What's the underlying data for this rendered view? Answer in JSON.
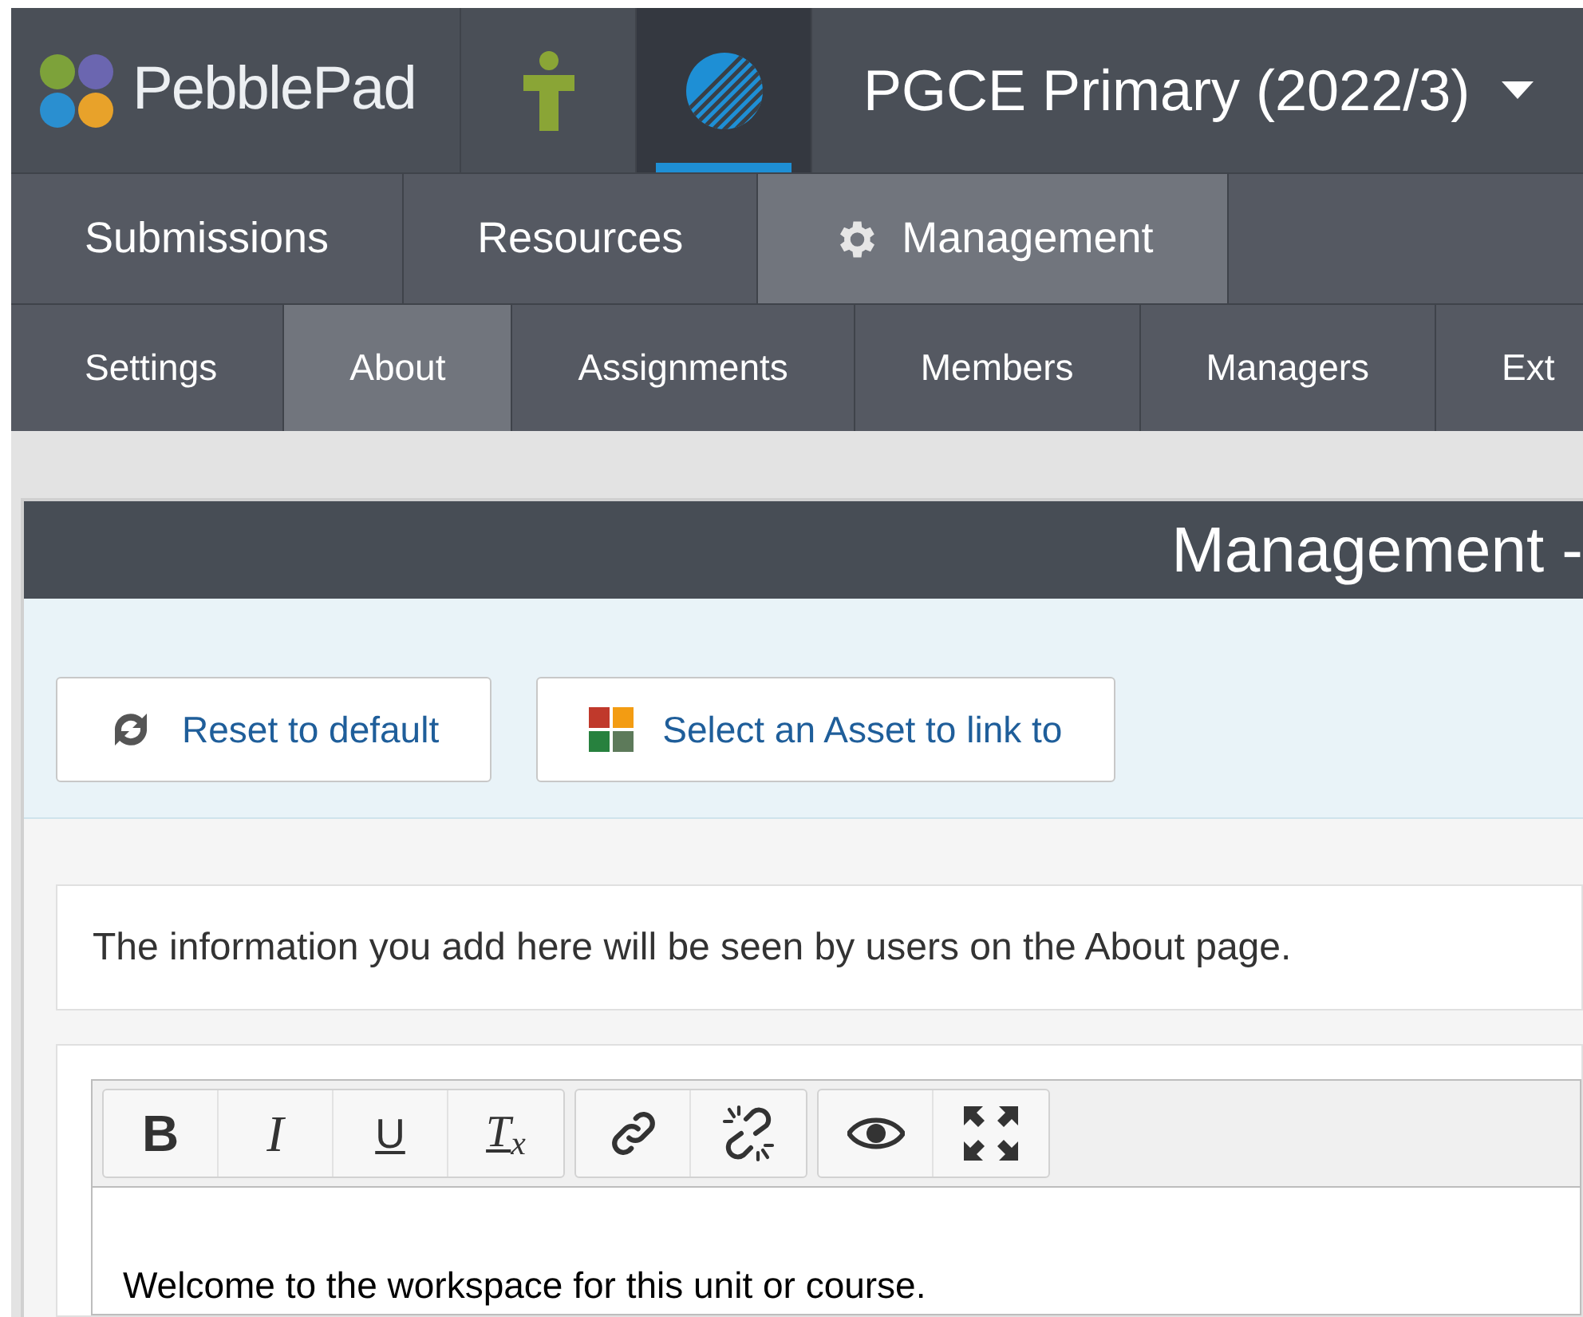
{
  "brand": {
    "name": "PebblePad"
  },
  "apps": [
    {
      "kind": "person",
      "selected": false
    },
    {
      "kind": "workspace",
      "selected": true
    }
  ],
  "workspace": {
    "title": "PGCE Primary (2022/3)"
  },
  "main_tabs": [
    {
      "label": "Submissions",
      "selected": false,
      "kind": "plain"
    },
    {
      "label": "Resources",
      "selected": false,
      "kind": "plain"
    },
    {
      "label": "Management",
      "selected": true,
      "kind": "gear"
    }
  ],
  "sub_tabs": [
    {
      "label": "Settings",
      "selected": false
    },
    {
      "label": "About",
      "selected": true
    },
    {
      "label": "Assignments",
      "selected": false
    },
    {
      "label": "Members",
      "selected": false
    },
    {
      "label": "Managers",
      "selected": false
    },
    {
      "label": "Ext",
      "selected": false
    }
  ],
  "panel": {
    "title": "Management -",
    "buttons": [
      {
        "label": "Reset to default",
        "kind": "reset"
      },
      {
        "label": "Select an Asset to link to",
        "kind": "asset"
      }
    ],
    "info": "The information you add here will be seen by users on the About page.",
    "editor": {
      "toolbar_groups": [
        [
          {
            "kind": "bold",
            "label": "B"
          },
          {
            "kind": "italic",
            "label": "I"
          },
          {
            "kind": "underline",
            "label": "U"
          },
          {
            "kind": "clear",
            "label": "T$_{x}$"
          }
        ],
        [
          {
            "kind": "link"
          },
          {
            "kind": "unlink"
          }
        ],
        [
          {
            "kind": "preview"
          },
          {
            "kind": "fullscreen"
          }
        ]
      ],
      "content": "Welcome to the workspace for this unit or course."
    }
  }
}
